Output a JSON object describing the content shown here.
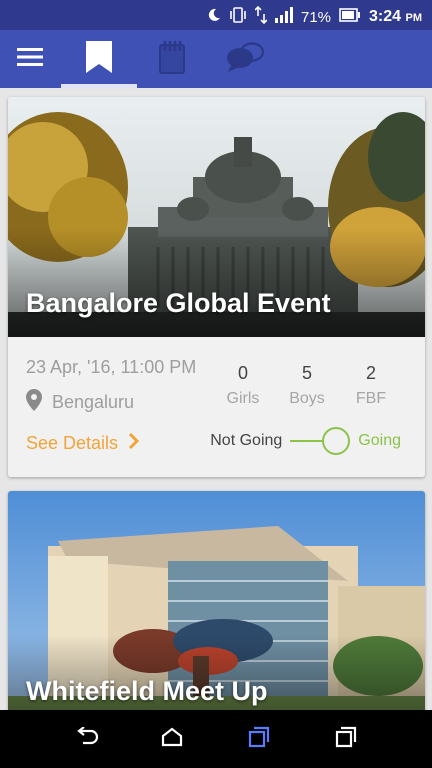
{
  "status_bar": {
    "battery_percent": "71%",
    "time": "3:24",
    "time_suffix": "PM"
  },
  "toolbar": {
    "menu_icon": "hamburger-menu-icon",
    "tabs": [
      {
        "icon": "bookmark-icon",
        "active": true
      },
      {
        "icon": "notes-icon",
        "active": false
      },
      {
        "icon": "chat-bubbles-icon",
        "active": false
      }
    ]
  },
  "events": [
    {
      "title": "Bangalore Global Event",
      "date": "23 Apr, '16, 11:00 PM",
      "location": "Bengaluru",
      "stats": [
        {
          "value": "0",
          "label": "Girls"
        },
        {
          "value": "5",
          "label": "Boys"
        },
        {
          "value": "2",
          "label": "FBF"
        }
      ],
      "see_details": "See Details",
      "not_going": "Not Going",
      "going": "Going",
      "going_toggle": "on"
    },
    {
      "title": "Whitefield Meet Up"
    }
  ],
  "colors": {
    "status_bar": "#2f3a8f",
    "toolbar": "#3f51b5",
    "accent_orange": "#f2a33a",
    "going_green": "#8bc34a"
  }
}
